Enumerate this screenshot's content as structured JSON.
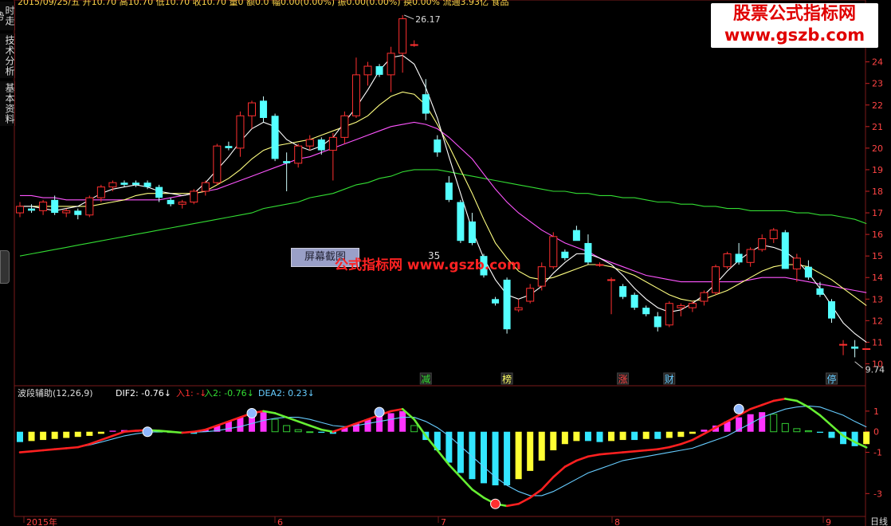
{
  "header": {
    "info": "2015/09/25/五 开10.70 高10.70 低10.70 收10.70 量0 额0.0 幅0.00(0.00%) 振0.00(0.00%) 换0.00% 流通3.93亿 食品",
    "high_label": "26.17",
    "low_label": "9.74",
    "mid_label": "35",
    "screenshot_label": "屏幕截图",
    "mid_watermark": "公式指标网 www.gszb.com"
  },
  "watermark": {
    "line1": "股票公式指标网",
    "line2": "www.gszb.com"
  },
  "sidetabs": [
    "时走势",
    "技术分析",
    "基本资料"
  ],
  "lower_panel": {
    "title": "波段辅助(12,26,9)",
    "dif": "DIF2: -0.76",
    "in1": "入1: -",
    "in2": "入2: -0.76",
    "dea": "DEA2: 0.23"
  },
  "signals": [
    "减",
    "榜",
    "涨",
    "财",
    "停"
  ],
  "x_axis": {
    "labels": [
      "2015年",
      "6",
      "7",
      "8",
      "9"
    ],
    "corner": "日线"
  },
  "colors": {
    "up": "#ff3030",
    "down": "#54ffff",
    "ma5": "#ffffff",
    "ma10": "#ffff80",
    "ma20": "#ff55ff",
    "ma60": "#33dd33",
    "grid": "#7a1a1a"
  },
  "chart_data": [
    {
      "type": "candlestick",
      "ylim": [
        9.5,
        26.5
      ],
      "yticks": [
        10,
        11,
        12,
        13,
        14,
        15,
        16,
        17,
        18,
        19,
        20,
        21,
        22,
        23,
        24
      ],
      "ohlc": [
        [
          17.0,
          17.5,
          16.8,
          17.3
        ],
        [
          17.2,
          17.4,
          17.0,
          17.1
        ],
        [
          17.1,
          17.6,
          16.9,
          17.5
        ],
        [
          17.6,
          17.8,
          16.9,
          17.0
        ],
        [
          17.0,
          17.2,
          16.8,
          17.1
        ],
        [
          17.1,
          17.2,
          16.7,
          16.9
        ],
        [
          16.9,
          17.8,
          16.8,
          17.7
        ],
        [
          17.7,
          18.3,
          17.5,
          18.2
        ],
        [
          18.2,
          18.5,
          18.0,
          18.4
        ],
        [
          18.4,
          18.5,
          18.2,
          18.3
        ],
        [
          18.4,
          18.5,
          18.2,
          18.3
        ],
        [
          18.4,
          18.5,
          18.1,
          18.2
        ],
        [
          18.2,
          18.3,
          17.5,
          17.7
        ],
        [
          17.6,
          17.7,
          17.3,
          17.4
        ],
        [
          17.4,
          17.6,
          17.2,
          17.5
        ],
        [
          17.5,
          18.1,
          17.4,
          18.0
        ],
        [
          18.0,
          18.5,
          17.8,
          18.4
        ],
        [
          18.4,
          20.2,
          18.3,
          20.1
        ],
        [
          20.1,
          20.3,
          19.9,
          20.0
        ],
        [
          20.0,
          21.7,
          19.6,
          21.5
        ],
        [
          21.5,
          22.2,
          20.9,
          22.1
        ],
        [
          22.2,
          22.4,
          21.2,
          21.4
        ],
        [
          21.5,
          21.6,
          19.4,
          19.5
        ],
        [
          19.4,
          19.8,
          18.0,
          19.3
        ],
        [
          19.3,
          20.2,
          19.1,
          20.1
        ],
        [
          20.1,
          20.6,
          19.9,
          20.4
        ],
        [
          20.4,
          20.5,
          19.7,
          19.9
        ],
        [
          19.9,
          20.7,
          18.5,
          20.5
        ],
        [
          20.5,
          21.7,
          20.2,
          21.5
        ],
        [
          21.5,
          24.2,
          21.4,
          23.4
        ],
        [
          23.4,
          24.0,
          22.9,
          23.8
        ],
        [
          23.8,
          23.9,
          23.3,
          23.4
        ],
        [
          23.4,
          24.7,
          22.6,
          24.4
        ],
        [
          24.4,
          26.17,
          23.5,
          26.0
        ],
        [
          24.8,
          25.0,
          24.7,
          24.8
        ],
        [
          22.5,
          23.2,
          21.3,
          21.6
        ],
        [
          20.4,
          20.6,
          19.6,
          19.8
        ],
        [
          18.4,
          18.7,
          17.5,
          17.6
        ],
        [
          17.5,
          17.6,
          15.6,
          15.7
        ],
        [
          16.6,
          17.0,
          15.5,
          15.6
        ],
        [
          15.0,
          15.1,
          14.0,
          14.1
        ],
        [
          13.0,
          13.1,
          12.7,
          12.8
        ],
        [
          13.9,
          14.0,
          11.4,
          11.6
        ],
        [
          12.5,
          13.0,
          12.4,
          12.6
        ],
        [
          12.9,
          13.7,
          12.8,
          13.5
        ],
        [
          13.6,
          14.7,
          13.4,
          14.5
        ],
        [
          14.5,
          16.1,
          14.4,
          15.9
        ],
        [
          15.2,
          15.3,
          14.8,
          14.9
        ],
        [
          16.2,
          16.4,
          15.8,
          15.7
        ],
        [
          15.6,
          16.0,
          14.6,
          14.7
        ],
        [
          14.6,
          14.7,
          14.5,
          14.6
        ],
        [
          13.9,
          14.0,
          12.3,
          13.9
        ],
        [
          13.6,
          13.7,
          13.0,
          13.1
        ],
        [
          13.2,
          13.3,
          12.5,
          12.6
        ],
        [
          12.6,
          12.7,
          12.2,
          12.3
        ],
        [
          12.2,
          12.4,
          11.5,
          11.7
        ],
        [
          11.8,
          12.9,
          11.7,
          12.8
        ],
        [
          12.6,
          12.8,
          12.2,
          12.7
        ],
        [
          12.6,
          12.9,
          12.4,
          12.8
        ],
        [
          12.9,
          13.4,
          12.7,
          13.3
        ],
        [
          13.3,
          14.6,
          13.2,
          14.5
        ],
        [
          14.5,
          15.2,
          14.4,
          15.1
        ],
        [
          15.1,
          15.6,
          14.6,
          14.7
        ],
        [
          14.7,
          15.4,
          14.5,
          15.3
        ],
        [
          15.3,
          16.0,
          15.2,
          15.8
        ],
        [
          15.8,
          16.3,
          15.6,
          16.2
        ],
        [
          16.1,
          16.2,
          14.4,
          14.4
        ],
        [
          14.4,
          15.1,
          13.8,
          14.9
        ],
        [
          14.5,
          14.8,
          13.9,
          14.0
        ],
        [
          13.5,
          13.8,
          13.1,
          13.2
        ],
        [
          12.9,
          13.0,
          11.9,
          12.1
        ],
        [
          10.9,
          11.1,
          10.4,
          10.9
        ],
        [
          10.8,
          11.1,
          10.3,
          10.7
        ],
        [
          10.7,
          10.7,
          10.7,
          10.7
        ]
      ],
      "ma5": [
        17.3,
        17.3,
        17.2,
        17.1,
        17.2,
        17.3,
        17.6,
        17.9,
        18.1,
        18.2,
        18.3,
        18.2,
        18.0,
        17.9,
        17.8,
        17.9,
        18.4,
        19.0,
        19.6,
        20.3,
        20.9,
        21.2,
        21.0,
        20.4,
        20.1,
        19.9,
        20.1,
        20.5,
        21.2,
        21.9,
        22.7,
        23.6,
        24.2,
        24.3,
        23.9,
        22.8,
        21.4,
        19.6,
        17.9,
        16.2,
        14.9,
        13.9,
        13.2,
        13.0,
        13.2,
        13.6,
        14.2,
        14.7,
        15.1,
        15.1,
        14.9,
        14.6,
        14.1,
        13.5,
        13.0,
        12.6,
        12.4,
        12.5,
        12.8,
        13.2,
        13.7,
        14.3,
        14.8,
        15.2,
        15.5,
        15.4,
        15.2,
        14.8,
        14.2,
        13.5,
        12.7,
        11.9,
        11.4,
        11.0
      ],
      "ma10": [
        17.3,
        17.3,
        17.3,
        17.3,
        17.3,
        17.3,
        17.3,
        17.4,
        17.5,
        17.6,
        17.8,
        17.9,
        17.9,
        17.9,
        17.9,
        17.9,
        18.0,
        18.3,
        18.6,
        19.0,
        19.5,
        19.9,
        20.1,
        20.2,
        20.3,
        20.4,
        20.6,
        20.8,
        21.0,
        21.2,
        21.5,
        22.0,
        22.4,
        22.6,
        22.5,
        22.0,
        21.1,
        20.1,
        19.0,
        17.9,
        16.7,
        15.6,
        14.9,
        14.3,
        14.0,
        13.9,
        14.0,
        14.2,
        14.4,
        14.6,
        14.6,
        14.5,
        14.3,
        14.1,
        13.8,
        13.5,
        13.2,
        13.0,
        12.9,
        13.0,
        13.2,
        13.4,
        13.7,
        14.0,
        14.3,
        14.5,
        14.6,
        14.6,
        14.5,
        14.2,
        13.9,
        13.5,
        13.1,
        12.7
      ],
      "ma20": [
        17.8,
        17.8,
        17.7,
        17.7,
        17.6,
        17.6,
        17.6,
        17.6,
        17.6,
        17.6,
        17.6,
        17.6,
        17.6,
        17.7,
        17.8,
        17.9,
        18.0,
        18.1,
        18.3,
        18.5,
        18.7,
        18.9,
        19.1,
        19.3,
        19.5,
        19.6,
        19.8,
        20.0,
        20.2,
        20.4,
        20.6,
        20.8,
        21.0,
        21.1,
        21.2,
        21.1,
        20.9,
        20.5,
        20.0,
        19.5,
        18.8,
        18.1,
        17.5,
        17.0,
        16.6,
        16.2,
        15.9,
        15.6,
        15.4,
        15.2,
        14.9,
        14.7,
        14.5,
        14.3,
        14.1,
        14.0,
        13.9,
        13.8,
        13.8,
        13.8,
        13.8,
        13.8,
        13.8,
        13.9,
        14.0,
        14.0,
        14.0,
        13.9,
        13.8,
        13.7,
        13.6,
        13.5,
        13.4,
        13.3
      ],
      "ma60": [
        15.0,
        15.1,
        15.2,
        15.3,
        15.4,
        15.5,
        15.6,
        15.7,
        15.8,
        15.9,
        16.0,
        16.1,
        16.2,
        16.3,
        16.4,
        16.5,
        16.6,
        16.7,
        16.8,
        16.9,
        17.0,
        17.2,
        17.3,
        17.4,
        17.5,
        17.7,
        17.8,
        17.9,
        18.1,
        18.3,
        18.4,
        18.6,
        18.7,
        18.9,
        19.0,
        19.0,
        19.0,
        18.9,
        18.8,
        18.7,
        18.6,
        18.5,
        18.4,
        18.3,
        18.2,
        18.1,
        18.0,
        18.0,
        17.9,
        17.9,
        17.8,
        17.8,
        17.7,
        17.7,
        17.6,
        17.5,
        17.5,
        17.4,
        17.4,
        17.3,
        17.3,
        17.2,
        17.2,
        17.1,
        17.1,
        17.1,
        17.1,
        17.0,
        17.0,
        16.9,
        16.9,
        16.8,
        16.7,
        16.5
      ]
    },
    {
      "type": "bar",
      "title": "波段辅助(12,26,9)",
      "ylim": [
        -3.8,
        2.0
      ],
      "yticks": [
        1,
        0,
        -1,
        -3
      ],
      "values": [
        -0.5,
        -0.45,
        -0.4,
        -0.35,
        -0.3,
        -0.25,
        -0.2,
        -0.1,
        0.05,
        0.08,
        0.08,
        0.05,
        0.02,
        0.0,
        -0.05,
        -0.1,
        0.1,
        0.3,
        0.5,
        0.7,
        0.9,
        0.95,
        0.6,
        0.3,
        0.1,
        0.0,
        -0.05,
        -0.1,
        0.2,
        0.4,
        0.6,
        0.75,
        0.9,
        1.0,
        0.3,
        -0.4,
        -0.9,
        -1.5,
        -2.0,
        -2.3,
        -2.5,
        -2.6,
        -2.6,
        -2.3,
        -1.9,
        -1.4,
        -0.9,
        -0.6,
        -0.45,
        -0.45,
        -0.5,
        -0.45,
        -0.4,
        -0.4,
        -0.35,
        -0.35,
        -0.3,
        -0.25,
        -0.1,
        0.1,
        0.3,
        0.5,
        0.7,
        0.85,
        0.95,
        0.85,
        0.4,
        0.15,
        0.05,
        -0.05,
        -0.3,
        -0.6,
        -0.7,
        -0.6
      ],
      "dif": [
        -1.0,
        -0.95,
        -0.9,
        -0.85,
        -0.8,
        -0.75,
        -0.6,
        -0.4,
        -0.2,
        0.0,
        0.05,
        0.08,
        0.05,
        0.0,
        -0.05,
        0.0,
        0.1,
        0.3,
        0.5,
        0.7,
        0.9,
        1.0,
        0.9,
        0.7,
        0.5,
        0.3,
        0.1,
        0.0,
        0.2,
        0.4,
        0.6,
        0.8,
        1.0,
        1.1,
        0.6,
        -0.2,
        -0.9,
        -1.6,
        -2.2,
        -2.8,
        -3.2,
        -3.5,
        -3.6,
        -3.5,
        -3.2,
        -2.8,
        -2.2,
        -1.7,
        -1.4,
        -1.2,
        -1.1,
        -1.05,
        -1.0,
        -0.95,
        -0.9,
        -0.85,
        -0.75,
        -0.6,
        -0.4,
        -0.1,
        0.2,
        0.5,
        0.8,
        1.1,
        1.3,
        1.5,
        1.6,
        1.5,
        1.2,
        0.8,
        0.3,
        -0.2,
        -0.5,
        -0.76
      ],
      "dea": [
        -1.0,
        -0.95,
        -0.9,
        -0.85,
        -0.8,
        -0.75,
        -0.65,
        -0.5,
        -0.35,
        -0.2,
        -0.1,
        -0.03,
        0.0,
        0.0,
        -0.02,
        -0.02,
        0.0,
        0.05,
        0.15,
        0.25,
        0.4,
        0.55,
        0.65,
        0.7,
        0.7,
        0.6,
        0.45,
        0.3,
        0.25,
        0.3,
        0.4,
        0.5,
        0.6,
        0.7,
        0.7,
        0.5,
        0.2,
        -0.2,
        -0.7,
        -1.2,
        -1.7,
        -2.2,
        -2.6,
        -2.9,
        -3.1,
        -3.1,
        -2.9,
        -2.6,
        -2.3,
        -2.0,
        -1.8,
        -1.6,
        -1.4,
        -1.3,
        -1.2,
        -1.1,
        -1.0,
        -0.9,
        -0.8,
        -0.6,
        -0.4,
        -0.2,
        0.1,
        0.4,
        0.7,
        0.9,
        1.1,
        1.2,
        1.25,
        1.2,
        1.0,
        0.8,
        0.5,
        0.23
      ]
    }
  ]
}
